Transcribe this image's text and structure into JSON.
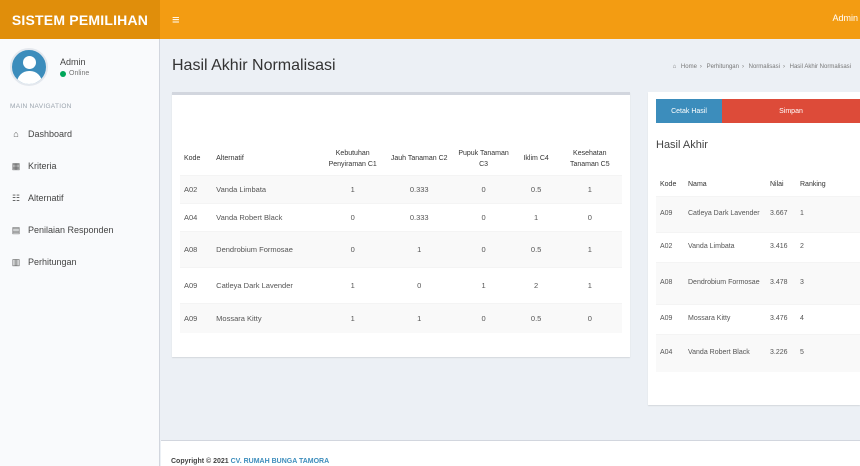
{
  "header": {
    "brand": "SISTEM PEMILIHAN",
    "toggle_icon": "≡",
    "user": "Admin"
  },
  "sidebar": {
    "user_name": "Admin",
    "user_status": "Online",
    "menu_header": "MAIN NAVIGATION",
    "items": [
      {
        "icon": "⌂",
        "label": "Dashboard"
      },
      {
        "icon": "▦",
        "label": "Kriteria"
      },
      {
        "icon": "☷",
        "label": "Alternatif"
      },
      {
        "icon": "▤",
        "label": "Penilaian Responden"
      },
      {
        "icon": "▥",
        "label": "Perhitungan"
      }
    ]
  },
  "page": {
    "title": "Hasil Akhir Normalisasi",
    "breadcrumb": [
      "Home",
      "Perhitungan",
      "Normalisasi",
      "Hasil Akhir Normalisasi"
    ]
  },
  "table1": {
    "headers": [
      "Kode",
      "Alternatif",
      "Kebutuhan Penyiraman C1",
      "Jauh Tanaman C2",
      "Pupuk Tanaman C3",
      "Iklim C4",
      "Kesehatan Tanaman C5"
    ],
    "rows": [
      [
        "A02",
        "Vanda Limbata",
        "1",
        "0.333",
        "0",
        "0.5",
        "1"
      ],
      [
        "A04",
        "Vanda Robert Black",
        "0",
        "0.333",
        "0",
        "1",
        "0"
      ],
      [
        "A08",
        "Dendrobium Formosae",
        "0",
        "1",
        "0",
        "0.5",
        "1"
      ],
      [
        "A09",
        "Catleya Dark Lavender",
        "1",
        "0",
        "1",
        "2",
        "1"
      ],
      [
        "A09",
        "Mossara Kitty",
        "1",
        "1",
        "0",
        "0.5",
        "0"
      ]
    ]
  },
  "buttons": {
    "cetak": "Cetak Hasil",
    "simpan": "Simpan"
  },
  "table2": {
    "title": "Hasil Akhir",
    "headers": [
      "Kode",
      "Nama",
      "Nilai",
      "Ranking"
    ],
    "rows": [
      [
        "A09",
        "Catleya Dark Lavender",
        "3.667",
        "1"
      ],
      [
        "A02",
        "Vanda Limbata",
        "3.416",
        "2"
      ],
      [
        "A08",
        "Dendrobium Formosae",
        "3.478",
        "3"
      ],
      [
        "A09",
        "Mossara Kitty",
        "3.476",
        "4"
      ],
      [
        "A04",
        "Vanda Robert Black",
        "3.226",
        "5"
      ]
    ]
  },
  "footer": {
    "prefix": "Copyright © 2021",
    "company": "CV. RUMAH BUNGA TAMORA"
  }
}
